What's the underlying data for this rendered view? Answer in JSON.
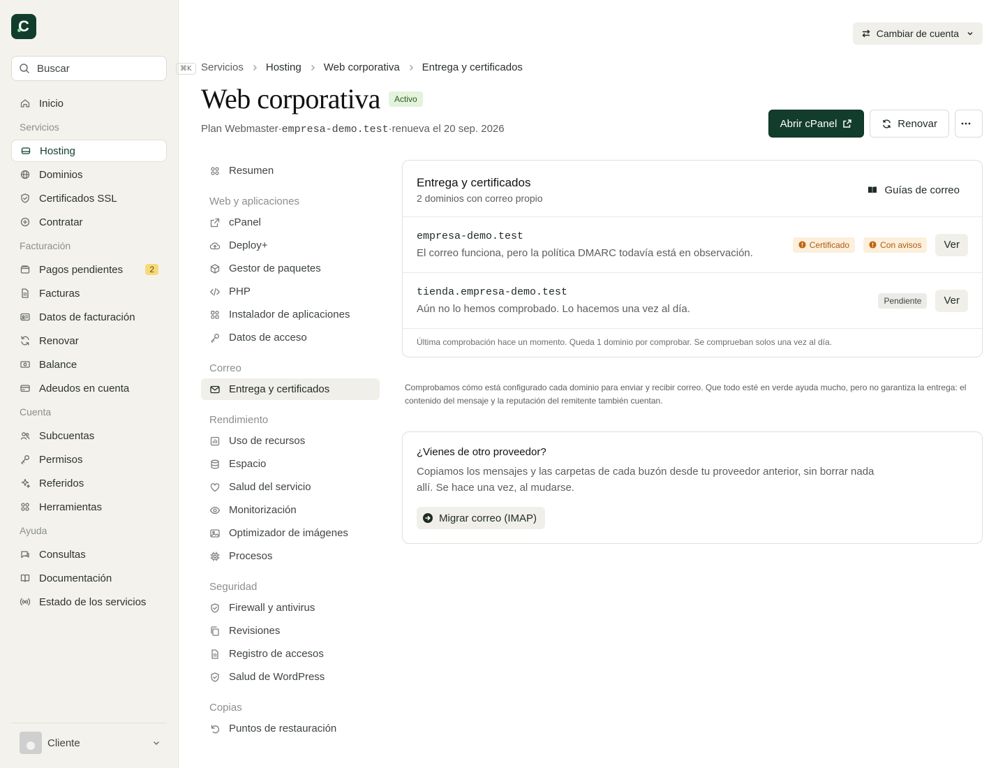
{
  "sidebar": {
    "search_placeholder": "Buscar",
    "shortcut": "⌘K",
    "items": [
      {
        "type": "item",
        "label": "Inicio",
        "icon": "home-icon"
      },
      {
        "type": "heading",
        "label": "Servicios"
      },
      {
        "type": "item",
        "label": "Hosting",
        "icon": "server-icon",
        "active": true
      },
      {
        "type": "item",
        "label": "Dominios",
        "icon": "globe-icon"
      },
      {
        "type": "item",
        "label": "Certificados SSL",
        "icon": "shield-icon"
      },
      {
        "type": "item",
        "label": "Contratar",
        "icon": "plus-circle-icon"
      },
      {
        "type": "heading",
        "label": "Facturación"
      },
      {
        "type": "item",
        "label": "Pagos pendientes",
        "icon": "wallet-icon",
        "badge": "2"
      },
      {
        "type": "item",
        "label": "Facturas",
        "icon": "file-icon"
      },
      {
        "type": "item",
        "label": "Datos de facturación",
        "icon": "id-card-icon"
      },
      {
        "type": "item",
        "label": "Renovar",
        "icon": "refresh-icon"
      },
      {
        "type": "item",
        "label": "Balance",
        "icon": "banknote-icon"
      },
      {
        "type": "item",
        "label": "Adeudos en cuenta",
        "icon": "credit-card-icon"
      },
      {
        "type": "heading",
        "label": "Cuenta"
      },
      {
        "type": "item",
        "label": "Subcuentas",
        "icon": "users-icon"
      },
      {
        "type": "item",
        "label": "Permisos",
        "icon": "key-icon"
      },
      {
        "type": "item",
        "label": "Referidos",
        "icon": "sparkles-icon"
      },
      {
        "type": "item",
        "label": "Herramientas",
        "icon": "grid-icon"
      },
      {
        "type": "heading",
        "label": "Ayuda"
      },
      {
        "type": "item",
        "label": "Consultas",
        "icon": "chat-icon"
      },
      {
        "type": "item",
        "label": "Documentación",
        "icon": "book-icon"
      },
      {
        "type": "item",
        "label": "Estado de los servicios",
        "icon": "broadcast-icon"
      }
    ],
    "user": {
      "name": "Cliente"
    }
  },
  "header": {
    "switch_account": "Cambiar de cuenta",
    "breadcrumb": [
      "Servicios",
      "Hosting",
      "Web corporativa",
      "Entrega y certificados"
    ],
    "title": "Web corporativa",
    "status": "Activo",
    "subtitle_plan": "Plan Webmaster",
    "subtitle_domain": "empresa-demo.test",
    "subtitle_renew": "renueva el 20 sep. 2026",
    "subtitle_sep": "·",
    "open_cpanel": "Abrir cPanel",
    "renew": "Renovar"
  },
  "subnav": [
    {
      "type": "item",
      "label": "Resumen",
      "icon": "grid-icon"
    },
    {
      "type": "heading",
      "label": "Web y aplicaciones"
    },
    {
      "type": "item",
      "label": "cPanel",
      "icon": "external-link-icon"
    },
    {
      "type": "item",
      "label": "Deploy+",
      "icon": "cloud-upload-icon"
    },
    {
      "type": "item",
      "label": "Gestor de paquetes",
      "icon": "package-icon"
    },
    {
      "type": "item",
      "label": "PHP",
      "icon": "code-icon"
    },
    {
      "type": "item",
      "label": "Instalador de aplicaciones",
      "icon": "apps-icon"
    },
    {
      "type": "item",
      "label": "Datos de acceso",
      "icon": "key-icon"
    },
    {
      "type": "heading",
      "label": "Correo"
    },
    {
      "type": "item",
      "label": "Entrega y certificados",
      "icon": "mail-icon",
      "active": true
    },
    {
      "type": "heading",
      "label": "Rendimiento"
    },
    {
      "type": "item",
      "label": "Uso de recursos",
      "icon": "chart-icon"
    },
    {
      "type": "item",
      "label": "Espacio",
      "icon": "database-icon"
    },
    {
      "type": "item",
      "label": "Salud del servicio",
      "icon": "heart-icon"
    },
    {
      "type": "item",
      "label": "Monitorización",
      "icon": "eye-icon"
    },
    {
      "type": "item",
      "label": "Optimizador de imágenes",
      "icon": "image-icon"
    },
    {
      "type": "item",
      "label": "Procesos",
      "icon": "cpu-icon"
    },
    {
      "type": "heading",
      "label": "Seguridad"
    },
    {
      "type": "item",
      "label": "Firewall y antivirus",
      "icon": "shield-icon"
    },
    {
      "type": "item",
      "label": "Revisiones",
      "icon": "copy-icon"
    },
    {
      "type": "item",
      "label": "Registro de accesos",
      "icon": "file-icon"
    },
    {
      "type": "item",
      "label": "Salud de WordPress",
      "icon": "shield-check-icon"
    },
    {
      "type": "heading",
      "label": "Copias"
    },
    {
      "type": "item",
      "label": "Puntos de restauración",
      "icon": "undo-icon"
    }
  ],
  "delivery": {
    "title": "Entrega y certificados",
    "subtitle": "2 dominios con correo propio",
    "guides": "Guías de correo",
    "domains": [
      {
        "domain": "empresa-demo.test",
        "desc": "El correo funciona, pero la política DMARC todavía está en observación.",
        "tags": [
          {
            "label": "Certificado",
            "kind": "warn"
          },
          {
            "label": "Con avisos",
            "kind": "warn"
          }
        ],
        "action": "Ver"
      },
      {
        "domain": "tienda.empresa-demo.test",
        "desc": "Aún no lo hemos comprobado. Lo hacemos una vez al día.",
        "tags": [
          {
            "label": "Pendiente",
            "kind": "pending"
          }
        ],
        "action": "Ver"
      }
    ],
    "footer": "Última comprobación hace un momento. Queda 1 dominio por comprobar. Se comprueban solos una vez al día."
  },
  "note": "Comprobamos cómo está configurado cada dominio para enviar y recibir correo. Que todo esté en verde ayuda mucho, pero no garantiza la entrega: el contenido del mensaje y la reputación del remitente también cuentan.",
  "migration": {
    "question": "¿Vienes de otro proveedor?",
    "text": "Copiamos los mensajes y las carpetas de cada buzón desde tu proveedor anterior, sin borrar nada allí. Se hace una vez, al mudarse.",
    "button": "Migrar correo (IMAP)"
  }
}
